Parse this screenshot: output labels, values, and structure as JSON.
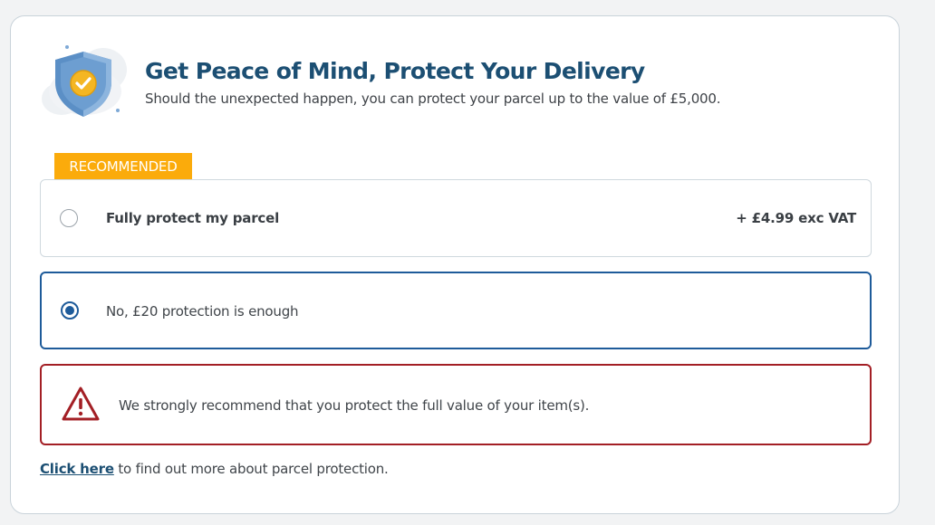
{
  "header": {
    "title": "Get Peace of Mind, Protect Your Delivery",
    "subtitle": "Should the unexpected happen, you can protect your parcel up to the value of £5,000."
  },
  "badge": {
    "label": "RECOMMENDED"
  },
  "options": [
    {
      "label": "Fully protect my parcel",
      "price": "+ £4.99 exc VAT",
      "selected": false
    },
    {
      "label": "No, £20 protection is enough",
      "selected": true
    }
  ],
  "warning": {
    "text": "We strongly recommend that you protect the full value of your item(s)."
  },
  "footer": {
    "link_label": "Click here",
    "rest_text": " to find out more about parcel protection."
  },
  "colors": {
    "brand_blue": "#1c4f73",
    "selected_blue": "#1e5b9a",
    "badge_orange": "#fbab0b",
    "warning_red": "#a31f25"
  },
  "icons": {
    "header": "shield-check-icon",
    "warning": "warning-triangle-icon"
  }
}
